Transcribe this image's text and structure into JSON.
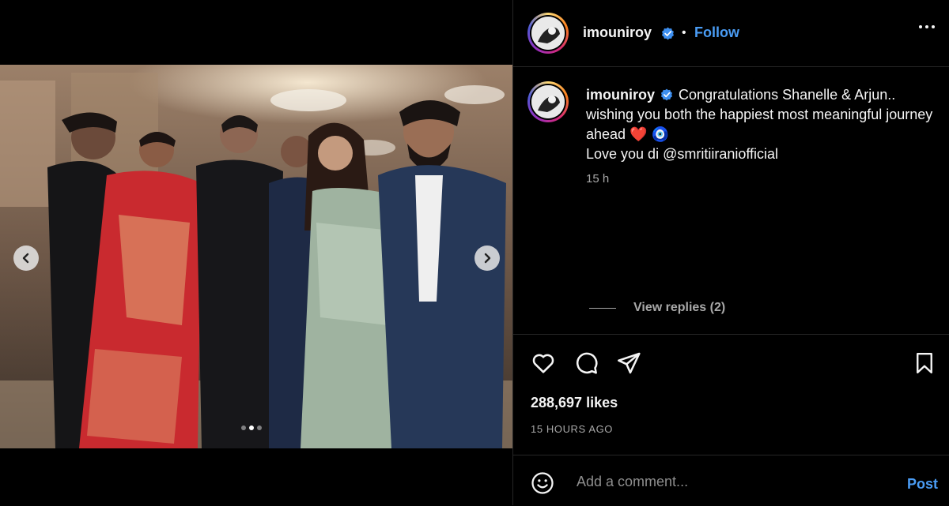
{
  "post": {
    "username": "imouniroy",
    "follow_label": "Follow",
    "separator": "•",
    "caption_text": "Congratulations Shanelle & Arjun.. wishing you both the happiest most meaningful journey ahead",
    "caption_emoji": "❤️ 🧿",
    "caption_line3": "Love you di @smritiiraniofficial",
    "comment_time": "15 h",
    "view_replies": "View replies (2)",
    "likes": "288,697 likes",
    "posted_ago": "15 HOURS AGO",
    "comment_placeholder": "Add a comment...",
    "post_label": "Post",
    "carousel_total": 3,
    "carousel_current": 2
  },
  "colors": {
    "accent": "#4a9cf4",
    "background": "#000000",
    "muted": "#a8a8a8",
    "divider": "#262626",
    "verified": "#3d8ff0"
  },
  "icons": [
    "verified-badge-icon",
    "more-options-icon",
    "heart-icon",
    "comment-icon",
    "share-icon",
    "bookmark-icon",
    "emoji-icon",
    "chevron-left-icon",
    "chevron-right-icon"
  ]
}
